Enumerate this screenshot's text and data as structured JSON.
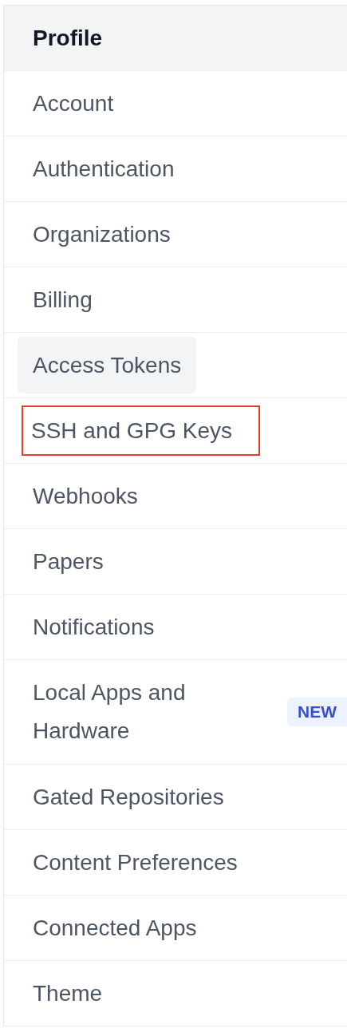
{
  "nav_items": [
    {
      "label": "Profile",
      "selected": true,
      "hovered": false,
      "annotated": false
    },
    {
      "label": "Account",
      "selected": false,
      "hovered": false,
      "annotated": false
    },
    {
      "label": "Authentication",
      "selected": false,
      "hovered": false,
      "annotated": false
    },
    {
      "label": "Organizations",
      "selected": false,
      "hovered": false,
      "annotated": false
    },
    {
      "label": "Billing",
      "selected": false,
      "hovered": false,
      "annotated": false
    },
    {
      "label": "Access Tokens",
      "selected": false,
      "hovered": true,
      "annotated": false
    },
    {
      "label": "SSH and GPG Keys",
      "selected": false,
      "hovered": false,
      "annotated": true
    },
    {
      "label": "Webhooks",
      "selected": false,
      "hovered": false,
      "annotated": false
    },
    {
      "label": "Papers",
      "selected": false,
      "hovered": false,
      "annotated": false
    },
    {
      "label": "Notifications",
      "selected": false,
      "hovered": false,
      "annotated": false
    },
    {
      "label": "Local Apps and Hardware",
      "selected": false,
      "hovered": false,
      "annotated": false,
      "badge": "NEW"
    },
    {
      "label": "Gated Repositories",
      "selected": false,
      "hovered": false,
      "annotated": false
    },
    {
      "label": "Content Preferences",
      "selected": false,
      "hovered": false,
      "annotated": false
    },
    {
      "label": "Connected Apps",
      "selected": false,
      "hovered": false,
      "annotated": false
    },
    {
      "label": "Theme",
      "selected": false,
      "hovered": false,
      "annotated": false
    }
  ]
}
